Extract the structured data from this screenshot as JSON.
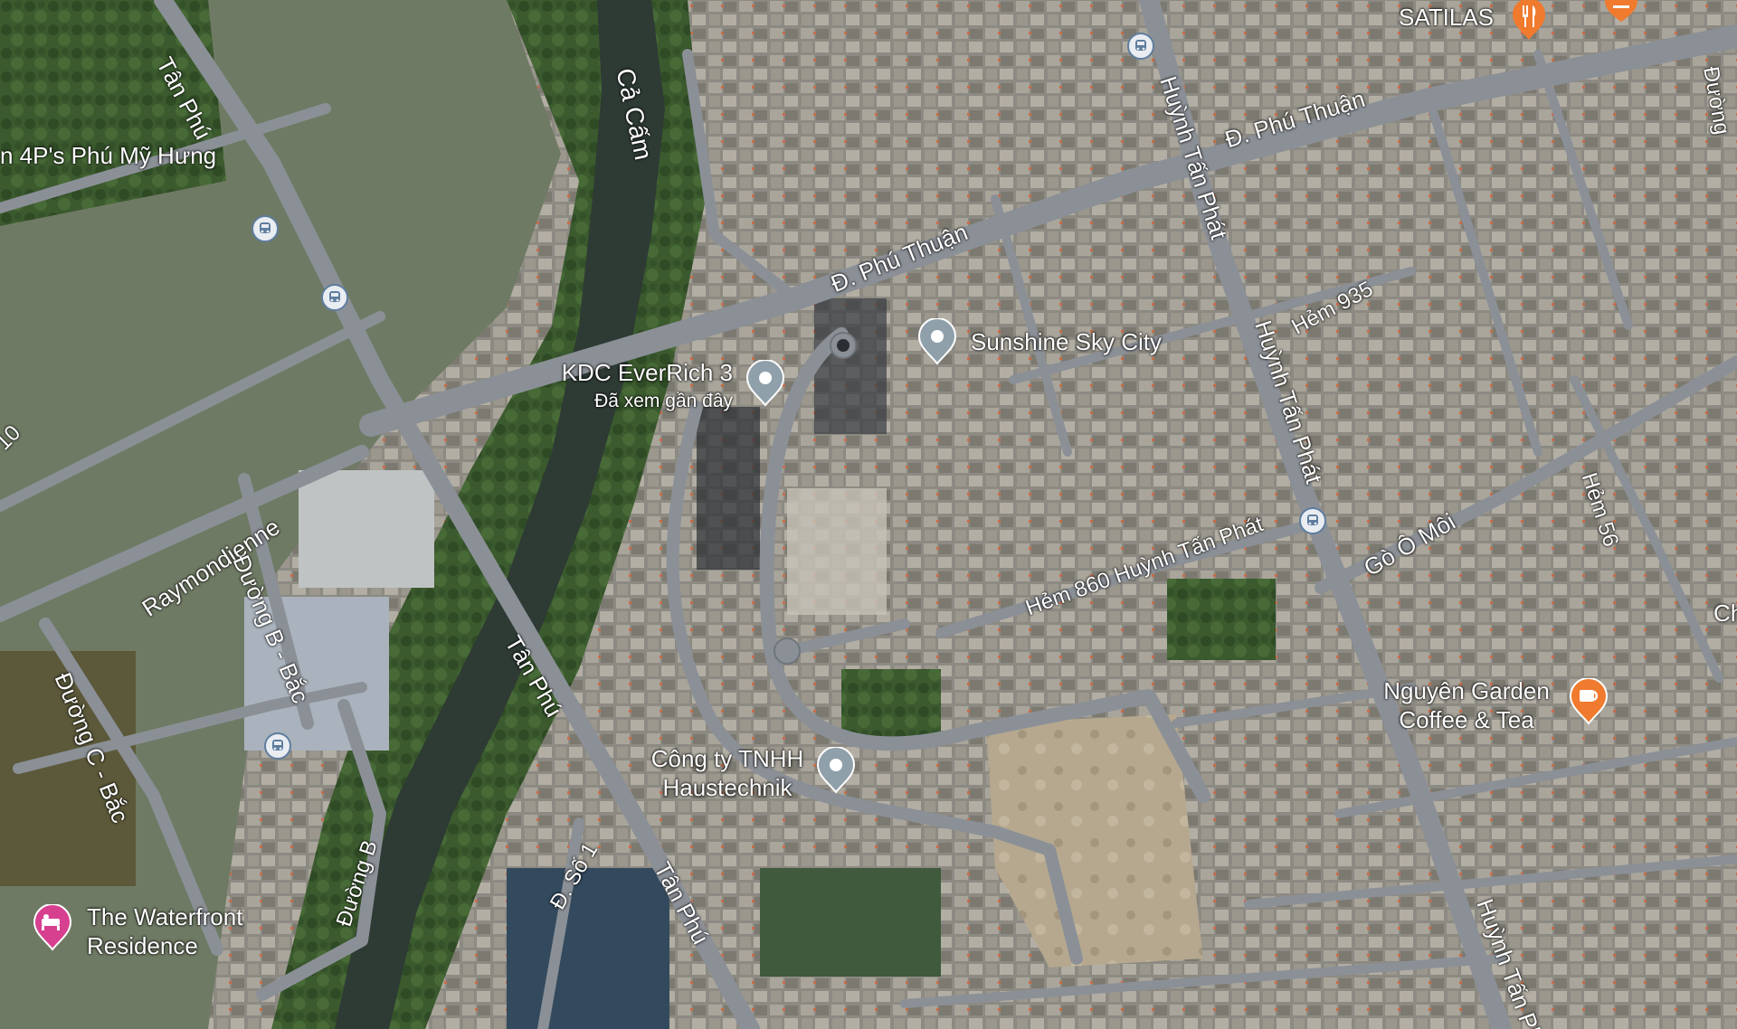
{
  "map": {
    "view": "satellite",
    "colors": {
      "road": "#8b9097",
      "road_edge": "#6f757c",
      "river": "#2e3a34",
      "greenery": "#3c5a2f",
      "pin_gray": "#8fa0ab",
      "pin_food": "#f07a2e",
      "pin_hotel": "#d6408f",
      "bus_blue": "#5e7d9e"
    },
    "streets": [
      {
        "id": "tan-phu-1",
        "text": "Tân Phú"
      },
      {
        "id": "tan-phu-2",
        "text": "Tân Phú"
      },
      {
        "id": "tan-phu-3",
        "text": "Tân Phú"
      },
      {
        "id": "phu-thuan-1",
        "text": "Đ. Phú Thuận"
      },
      {
        "id": "phu-thuan-2",
        "text": "Đ. Phú Thuận"
      },
      {
        "id": "huynh-tan-phat-1",
        "text": "Huỳnh Tấn Phát"
      },
      {
        "id": "huynh-tan-phat-2",
        "text": "Huỳnh Tấn Phát"
      },
      {
        "id": "huynh-tan-phat-3",
        "text": "Huỳnh Tấn Phá"
      },
      {
        "id": "hem-935",
        "text": "Hẻm 935"
      },
      {
        "id": "hem-860",
        "text": "Hẻm 860 Huỳnh Tấn Phát"
      },
      {
        "id": "go-o-moi",
        "text": "Gò Ô Môi"
      },
      {
        "id": "hem-56",
        "text": "Hẻm 56"
      },
      {
        "id": "raymondienne",
        "text": "Raymondienne"
      },
      {
        "id": "duong-b-bac",
        "text": "Đường B - Bắc"
      },
      {
        "id": "duong-c-bac",
        "text": "Đường C - Bắc"
      },
      {
        "id": "duong-b",
        "text": "Đường B"
      },
      {
        "id": "d-so-1",
        "text": "Đ. Số 1"
      },
      {
        "id": "ca-cam",
        "text": "Cả Cấm"
      },
      {
        "id": "duong-right",
        "text": "Đường"
      },
      {
        "id": "left-10",
        "text": "10"
      }
    ],
    "places": {
      "fourp": "n 4P's Phú Mỹ Hưng",
      "satilas": "SATILAS",
      "everrich_name": "KDC EverRich 3",
      "everrich_sub": "Đã xem gần đây",
      "sunshine": "Sunshine Sky City",
      "haustechnik_l1": "Công ty TNHH",
      "haustechnik_l2": "Haustechnik",
      "nguyen_l1": "Nguyên Garden",
      "nguyen_l2": "Coffee & Tea",
      "waterfront_l1": "The Waterfront",
      "waterfront_l2": "Residence",
      "ch": "Ch"
    },
    "icons": {
      "bus": "bus-stop-icon",
      "food": "restaurant-icon",
      "coffee": "coffee-icon",
      "hotel": "hotel-icon",
      "pin": "location-pin-icon"
    }
  }
}
